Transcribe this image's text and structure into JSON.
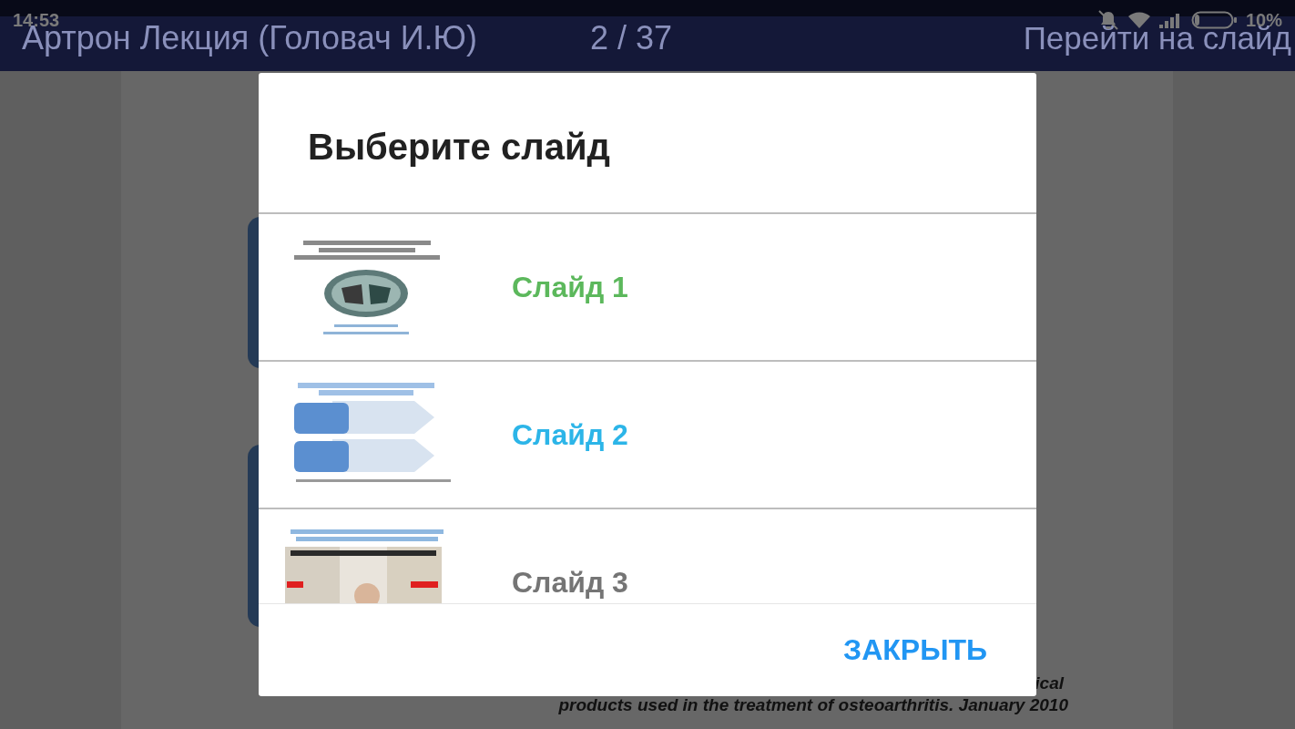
{
  "status_bar": {
    "time": "14:53",
    "battery": "10%"
  },
  "app_bar": {
    "title": "Артрон Лекция (Головач И.Ю)",
    "page": "2 / 37",
    "action": "Перейти на слайд"
  },
  "document": {
    "caption_end": "ical",
    "caption_line": "products used in the treatment of osteoarthritis. January 2010"
  },
  "dialog": {
    "title": "Выберите слайд",
    "slides": [
      {
        "label": "Слайд 1",
        "color": "#5cb85c"
      },
      {
        "label": "Слайд 2",
        "color": "#2cb5e8"
      },
      {
        "label": "Слайд 3",
        "color": "#757575"
      }
    ],
    "close_button": "ЗАКРЫТЬ"
  }
}
